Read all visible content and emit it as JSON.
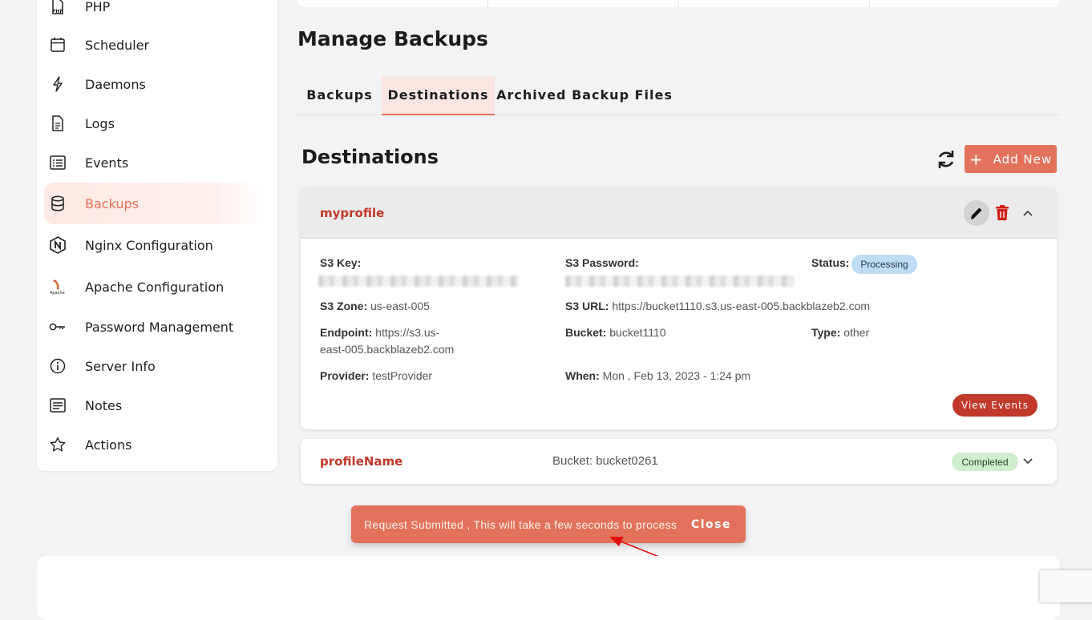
{
  "sidebar": {
    "items": [
      {
        "label": "PHP",
        "icon": "php-file-icon"
      },
      {
        "label": "Scheduler",
        "icon": "calendar-icon"
      },
      {
        "label": "Daemons",
        "icon": "bolt-icon"
      },
      {
        "label": "Logs",
        "icon": "document-icon"
      },
      {
        "label": "Events",
        "icon": "list-icon"
      },
      {
        "label": "Backups",
        "icon": "database-icon",
        "active": true
      },
      {
        "label": "Nginx Configuration",
        "icon": "nginx-icon"
      },
      {
        "label": "Apache Configuration",
        "icon": "apache-icon"
      },
      {
        "label": "Password Management",
        "icon": "key-icon"
      },
      {
        "label": "Server Info",
        "icon": "info-icon"
      },
      {
        "label": "Notes",
        "icon": "notes-icon"
      },
      {
        "label": "Actions",
        "icon": "star-icon"
      }
    ]
  },
  "page": {
    "title": "Manage Backups"
  },
  "tabs": [
    {
      "label": "Backups",
      "active": false
    },
    {
      "label": "Destinations",
      "active": true
    },
    {
      "label": "Archived Backup Files",
      "active": false
    }
  ],
  "section": {
    "title": "Destinations",
    "add_label": "Add New"
  },
  "destinations": [
    {
      "name": "myprofile",
      "expanded": true,
      "s3_key_label": "S3 Key:",
      "s3_password_label": "S3 Password:",
      "status_label": "Status:",
      "status": "Processing",
      "s3_zone_label": "S3 Zone:",
      "s3_zone": "us-east-005",
      "s3_url_label": "S3 URL:",
      "s3_url": "https://bucket1110.s3.us-east-005.backblazeb2.com",
      "endpoint_label": "Endpoint:",
      "endpoint_line1": "https://s3.us-",
      "endpoint_line2": "east-005.backblazeb2.com",
      "bucket_label": "Bucket:",
      "bucket": "bucket1110",
      "type_label": "Type:",
      "type": "other",
      "provider_label": "Provider:",
      "provider": "testProvider",
      "when_label": "When:",
      "when": "Mon , Feb 13, 2023 - 1:24 pm",
      "view_events_label": "View Events"
    },
    {
      "name": "profileName",
      "expanded": false,
      "bucket_text": "Bucket: bucket0261",
      "status": "Completed"
    }
  ],
  "toast": {
    "message": "Request Submitted , This will take a few seconds to process",
    "close_label": "Close"
  },
  "colors": {
    "accent": "#e2725b",
    "danger": "#c0392b",
    "processing_bg": "#bfdcf5",
    "completed_bg": "#cfeecd"
  }
}
